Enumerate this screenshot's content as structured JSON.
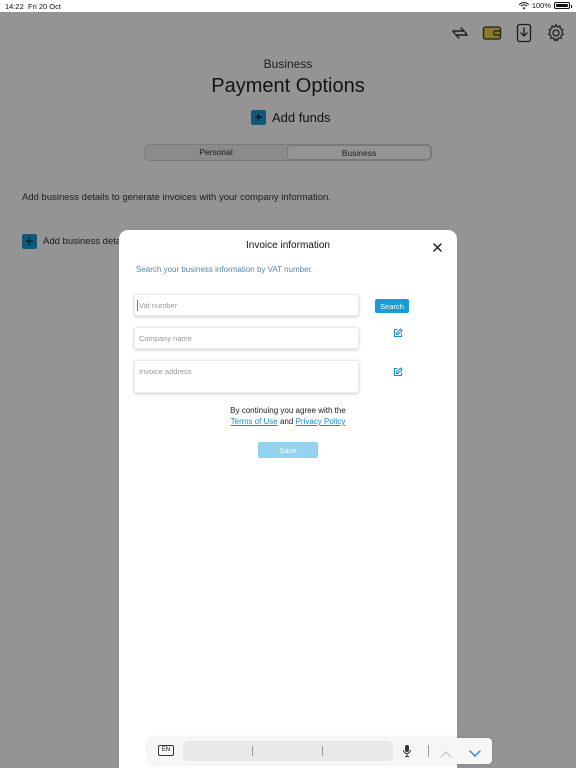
{
  "status": {
    "time": "14:22",
    "date": "Fri 20 Oct",
    "battery": "100%"
  },
  "app": {
    "subtitle": "Business",
    "title": "Payment Options",
    "add_funds": "Add funds",
    "segments": [
      "Personal",
      "Business"
    ],
    "selected_segment": "Business",
    "business_description": "Add business details to generate invoices with your company information.",
    "add_business_label": "Add business detai",
    "icons": [
      "transfer-icon",
      "wallet-icon",
      "download-icon",
      "settings-icon"
    ],
    "accent": "#1a9cd6"
  },
  "modal": {
    "title": "Invoice information",
    "hint": "Search your business information by VAT number.",
    "vat_placeholder": "Vat number",
    "vat_value": "",
    "company_placeholder": "Company name",
    "address_placeholder": "Invoice address",
    "search_label": "Search",
    "terms_prefix": "By continuing you agree with the",
    "terms_link": "Terms of Use",
    "terms_and": "and",
    "privacy_link": "Privacy Policy",
    "save_label": "Save"
  },
  "keyboard": {
    "language": "EN"
  }
}
